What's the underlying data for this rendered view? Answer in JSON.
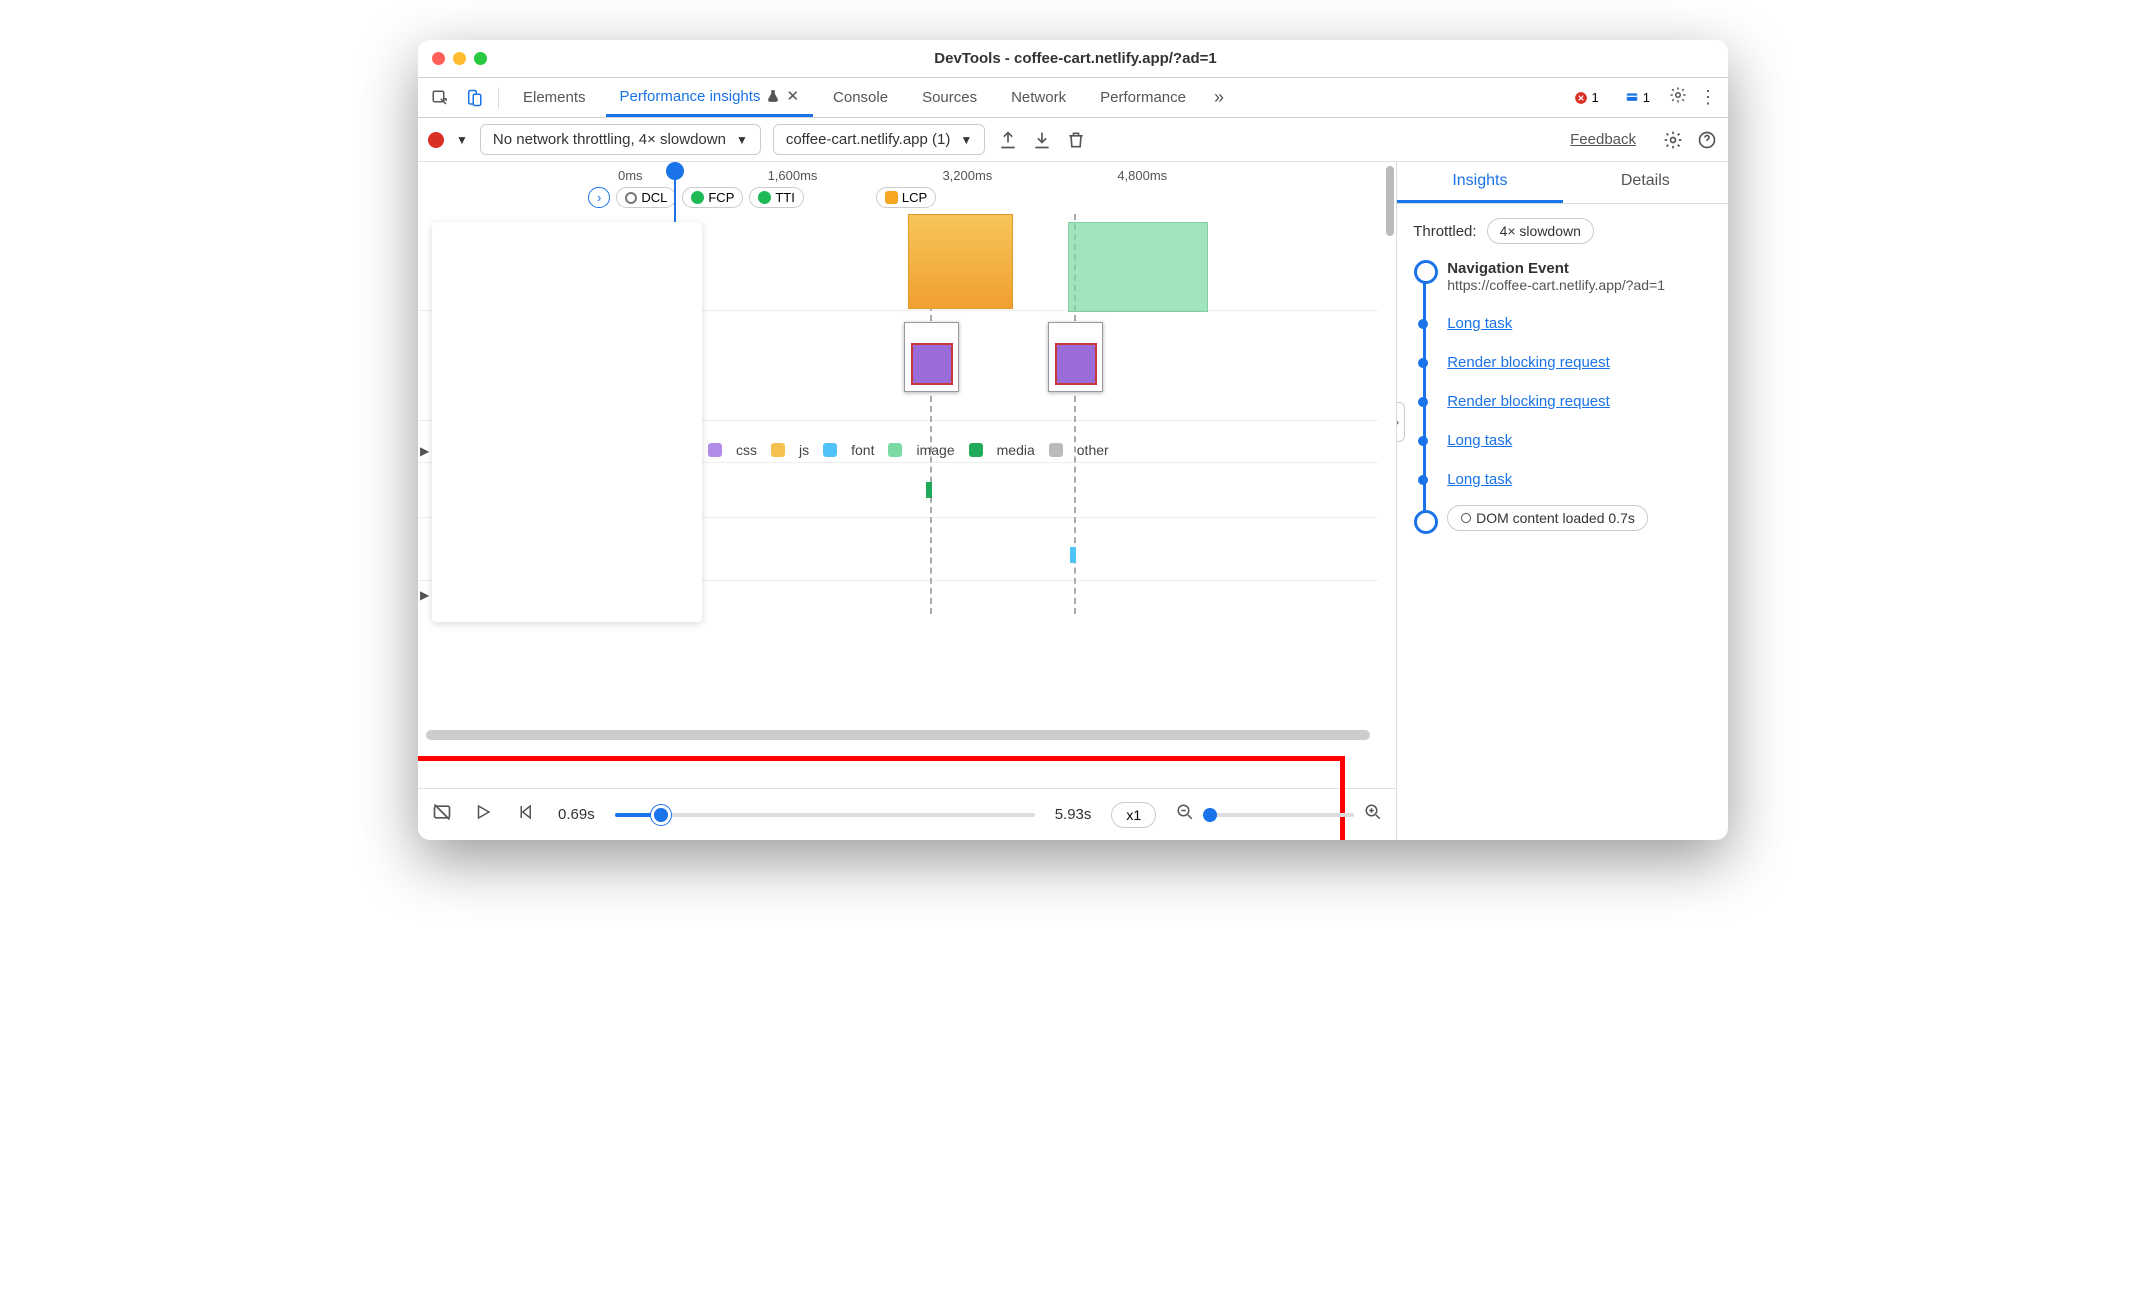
{
  "window": {
    "title": "DevTools - coffee-cart.netlify.app/?ad=1"
  },
  "tabs": {
    "elements": "Elements",
    "perf_insights": "Performance insights",
    "console": "Console",
    "sources": "Sources",
    "network": "Network",
    "performance": "Performance",
    "overflow_glyph": "»",
    "error_count": "1",
    "info_count": "1"
  },
  "toolbar": {
    "throttling": "No network throttling, 4× slowdown",
    "recording": "coffee-cart.netlify.app (1)",
    "feedback": "Feedback"
  },
  "ruler": {
    "t0": "0ms",
    "t1": "1,600ms",
    "t2": "3,200ms",
    "t3": "4,800ms"
  },
  "markers": {
    "dcl": "DCL",
    "fcp": "FCP",
    "tti": "TTI",
    "lcp": "LCP"
  },
  "legend": {
    "css": "css",
    "js": "js",
    "font": "font",
    "image": "image",
    "media": "media",
    "other": "other"
  },
  "playbar": {
    "start": "0.69s",
    "end": "5.93s",
    "speed": "x1"
  },
  "right": {
    "tab_insights": "Insights",
    "tab_details": "Details",
    "throttled_label": "Throttled:",
    "throttled_value": "4× slowdown",
    "items": {
      "nav_title": "Navigation Event",
      "nav_url": "https://coffee-cart.netlify.app/?ad=1",
      "long_task": "Long task",
      "rbr": "Render blocking request",
      "dcl": "DOM content loaded",
      "dcl_time": "0.7s"
    }
  }
}
